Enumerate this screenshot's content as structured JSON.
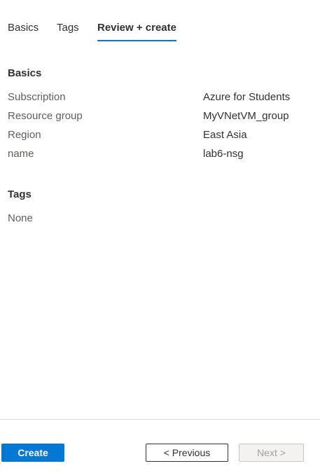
{
  "tabs": [
    {
      "label": "Basics"
    },
    {
      "label": "Tags"
    },
    {
      "label": "Review + create",
      "active": true
    }
  ],
  "basics": {
    "title": "Basics",
    "rows": [
      {
        "label": "Subscription",
        "value": "Azure for Students"
      },
      {
        "label": "Resource group",
        "value": "MyVNetVM_group"
      },
      {
        "label": "Region",
        "value": "East Asia"
      },
      {
        "label": "name",
        "value": "lab6-nsg"
      }
    ]
  },
  "tags": {
    "title": "Tags",
    "empty_text": "None"
  },
  "footer": {
    "create_label": "Create",
    "previous_label": "< Previous",
    "next_label": "Next >"
  },
  "colors": {
    "accent": "#0078d4",
    "text": "#323130",
    "muted": "#605e5c",
    "disabled_text": "#a19f9d"
  }
}
